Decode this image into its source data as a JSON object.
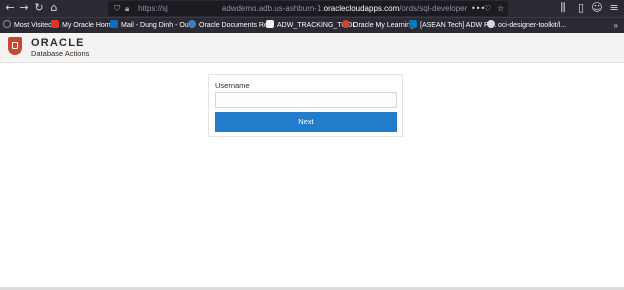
{
  "browser": {
    "url_prefix": "https://sj",
    "url_subdomain": "adwdemo.adb.us-ashburn-1.",
    "url_domain": "oraclecloudapps.com",
    "url_path": "/ords/sql-developer",
    "more_label": "•••"
  },
  "bookmarks": [
    {
      "label": "Most Visited",
      "color": "#8f8f9d"
    },
    {
      "label": "My Oracle Home",
      "color": "#e0332d"
    },
    {
      "label": "Mail - Dung Dinh - Ou...",
      "color": "#0f6cbd"
    },
    {
      "label": "Oracle Documents Re...",
      "color": "#3f7fbf"
    },
    {
      "label": "ADW_TRACKING_TOOL",
      "color": "#f2f2f2"
    },
    {
      "label": "Oracle My Learning",
      "color": "#c74634"
    },
    {
      "label": "[ASEAN Tech] ADW Pr...",
      "color": "#0079bf"
    },
    {
      "label": "oci-designer-toolkit/l...",
      "color": "#d8d8dc"
    }
  ],
  "app": {
    "brand": "ORACLE",
    "product": "Database Actions"
  },
  "login": {
    "username_label": "Username",
    "username_value": "",
    "username_placeholder": "",
    "next_label": "Next"
  }
}
